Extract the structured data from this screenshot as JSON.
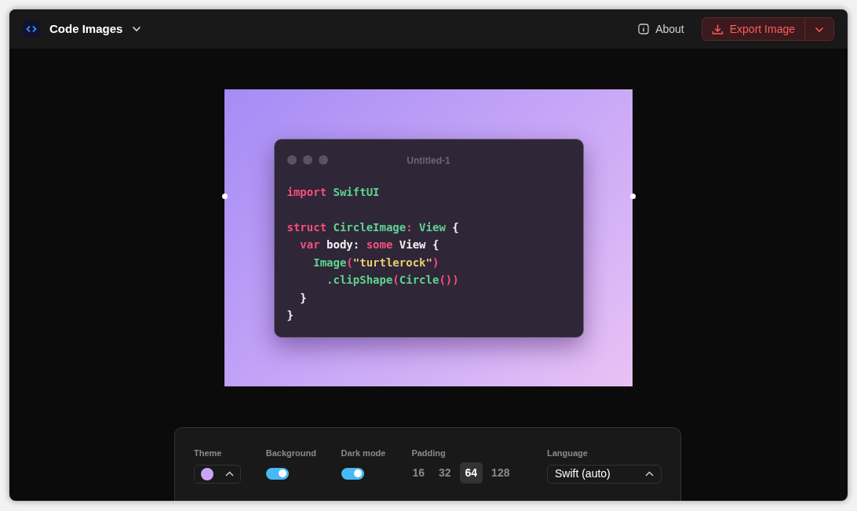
{
  "header": {
    "title": "Code Images",
    "about": "About",
    "export": "Export Image"
  },
  "frame": {
    "window_title": "Untitled-1",
    "lines": [
      {
        "tokens": [
          {
            "text": "import ",
            "kind": "keyword"
          },
          {
            "text": "SwiftUI",
            "kind": "type"
          }
        ]
      },
      {
        "blank_before": true,
        "tokens": [
          {
            "text": "struct ",
            "kind": "keyword"
          },
          {
            "text": "CircleImage",
            "kind": "type"
          },
          {
            "text": ": ",
            "kind": "keyword"
          },
          {
            "text": "View",
            "kind": "type"
          },
          {
            "text": " {",
            "kind": "plain"
          }
        ]
      },
      {
        "tokens": [
          {
            "text": "  var ",
            "kind": "keyword"
          },
          {
            "text": "body",
            "kind": "plain"
          },
          {
            "text": ": ",
            "kind": "plain"
          },
          {
            "text": "some ",
            "kind": "keyword"
          },
          {
            "text": "View {",
            "kind": "plain"
          }
        ]
      },
      {
        "tokens": [
          {
            "text": "    Image",
            "kind": "type"
          },
          {
            "text": "(",
            "kind": "keyword"
          },
          {
            "text": "\"turtlerock\"",
            "kind": "string"
          },
          {
            "text": ")",
            "kind": "keyword"
          }
        ]
      },
      {
        "tokens": [
          {
            "text": "      .clipShape",
            "kind": "type"
          },
          {
            "text": "(",
            "kind": "keyword"
          },
          {
            "text": "Circle",
            "kind": "type"
          },
          {
            "text": "())",
            "kind": "keyword"
          }
        ]
      },
      {
        "tokens": [
          {
            "text": "  }",
            "kind": "plain"
          }
        ]
      },
      {
        "tokens": [
          {
            "text": "}",
            "kind": "plain"
          }
        ]
      }
    ]
  },
  "toolbar": {
    "theme": {
      "label": "Theme",
      "color": "#c9a6f5"
    },
    "background": {
      "label": "Background",
      "on": true
    },
    "dark_mode": {
      "label": "Dark mode",
      "on": true
    },
    "padding": {
      "label": "Padding",
      "options": [
        {
          "label": "16",
          "selected": false
        },
        {
          "label": "32",
          "selected": false
        },
        {
          "label": "64",
          "selected": true
        },
        {
          "label": "128",
          "selected": false
        }
      ]
    },
    "language": {
      "label": "Language",
      "value": "Swift (auto)"
    }
  }
}
